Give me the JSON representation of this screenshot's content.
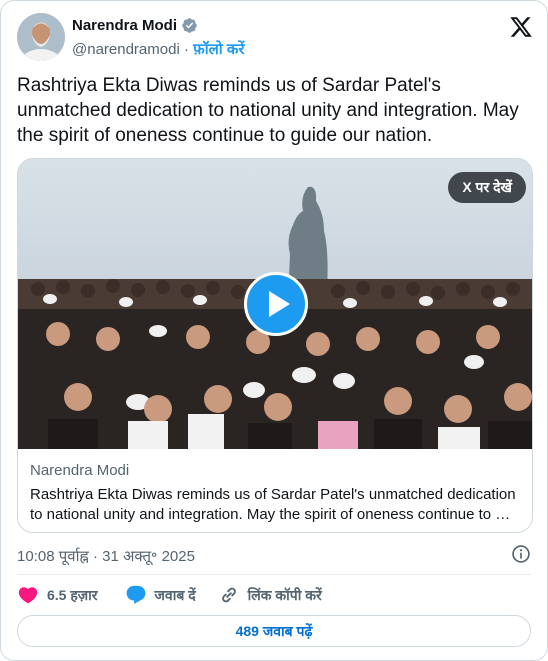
{
  "author": {
    "name": "Narendra Modi",
    "handle": "@narendramodi",
    "separator": " · ",
    "follow_label": "फ़ॉलो करें"
  },
  "icons": {
    "verified": "verified-badge-icon",
    "brand": "x-logo-icon",
    "info": "info-icon",
    "like": "heart-icon",
    "reply": "comment-bubble-icon",
    "copy_link": "link-icon",
    "play": "play-icon"
  },
  "colors": {
    "accent": "#1d9bf0",
    "like": "#f91880",
    "muted": "#536471",
    "text": "#0f1419"
  },
  "tweet": {
    "text": "Rashtriya Ekta Diwas reminds us of Sardar Patel's unmatched dedication to national unity and integration. May the spirit of oneness continue to guide our nation."
  },
  "media": {
    "watch_on_x_label": "X पर देखें",
    "card_author": "Narendra Modi",
    "card_text": "Rashtriya Ekta Diwas reminds us of Sardar Patel's unmatched dedication to national unity and integration. May the spirit of oneness continue to …"
  },
  "meta": {
    "timestamp": "10:08 पूर्वाह्न · 31 अक्तू॰ 2025"
  },
  "actions": {
    "like_count": "6.5 हज़ार",
    "reply_label": "जवाब दें",
    "copy_link_label": "लिंक कॉपी करें"
  },
  "replies": {
    "label": "489 जवाब पढ़ें"
  }
}
